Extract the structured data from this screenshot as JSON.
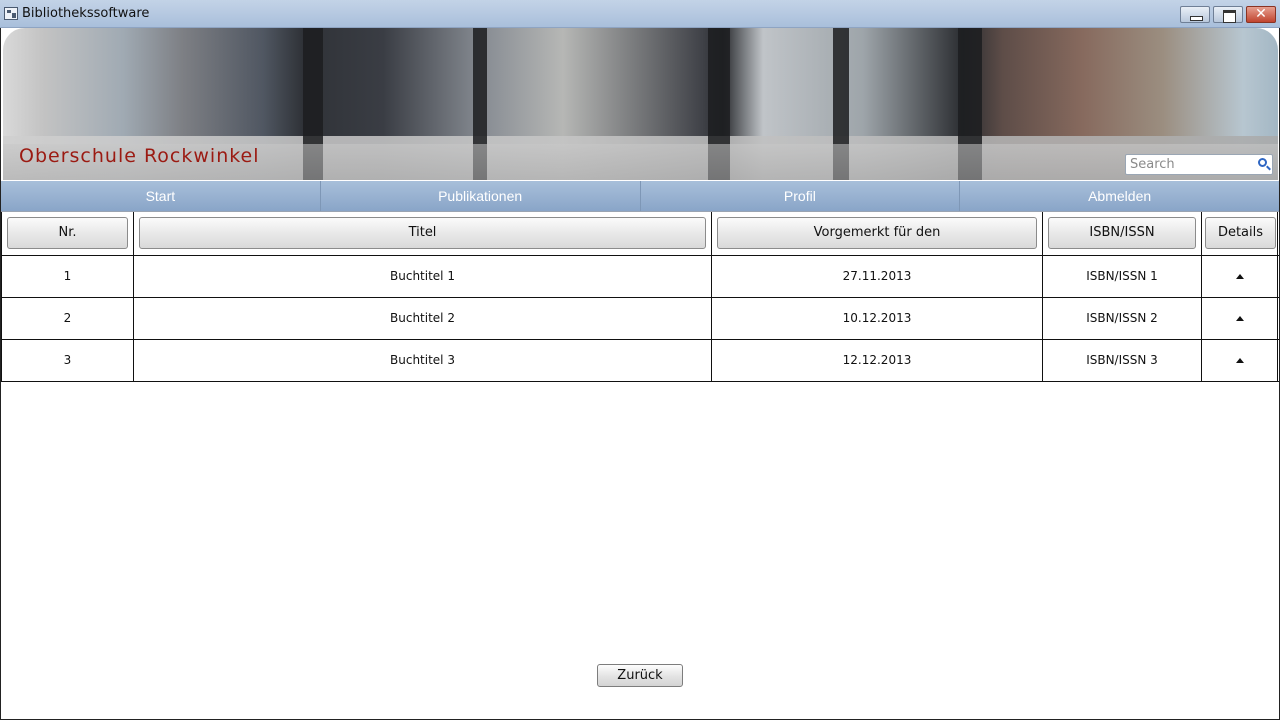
{
  "window": {
    "title": "Bibliothekssoftware"
  },
  "banner": {
    "school_name": "Oberschule Rockwinkel",
    "search_placeholder": "Search"
  },
  "nav": {
    "items": [
      {
        "label": "Start"
      },
      {
        "label": "Publikationen"
      },
      {
        "label": "Profil"
      },
      {
        "label": "Abmelden"
      }
    ]
  },
  "table": {
    "headers": [
      "Nr.",
      "Titel",
      "Vorgemerkt für den",
      "ISBN/ISSN",
      "Details"
    ],
    "rows": [
      {
        "nr": "1",
        "titel": "Buchtitel 1",
        "datum": "27.11.2013",
        "isbn": "ISBN/ISSN 1"
      },
      {
        "nr": "2",
        "titel": "Buchtitel 2",
        "datum": "10.12.2013",
        "isbn": "ISBN/ISSN 2"
      },
      {
        "nr": "3",
        "titel": "Buchtitel 3",
        "datum": "12.12.2013",
        "isbn": "ISBN/ISSN 3"
      }
    ]
  },
  "footer": {
    "back_label": "Zurück"
  },
  "colors": {
    "nav_bg": "#89a5c8",
    "school_name": "#9b1a12",
    "titlebar": "#b3c6de"
  },
  "icons": {
    "app": "app-window-icon",
    "search": "magnifier-icon",
    "details": "triangle-up-icon"
  }
}
